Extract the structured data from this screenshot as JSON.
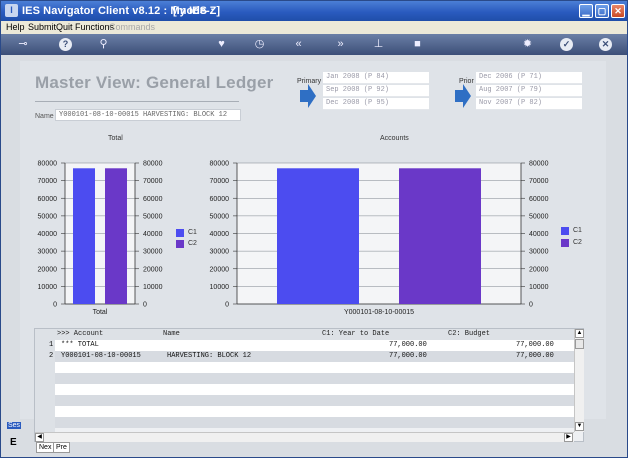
{
  "window": {
    "title": "IES Navigator Client v8.12 : My IES :",
    "mode": "[mode-Z]",
    "icon_letter": "I"
  },
  "menu": [
    "Help",
    "Submit",
    "Quit",
    "Functions",
    "Commands"
  ],
  "menu_disabled": [
    "Commands"
  ],
  "toolbar_icons": [
    "key-icon",
    "help-icon",
    "search-icon",
    "heart-icon",
    "clock-icon",
    "rewind-icon",
    "fast-forward-icon",
    "pin-icon",
    "stop-icon",
    "settings-icon",
    "check-icon",
    "close-icon"
  ],
  "view": {
    "title": "Master View: General Ledger",
    "name_label": "Name",
    "name_value": "Y000101-08-10-00015 HARVESTING: BLOCK 12"
  },
  "primary": {
    "label": "Primary",
    "periods": [
      "Jan 2008 (P 84)",
      "Sep 2008 (P 92)",
      "Dec 2008 (P 95)"
    ]
  },
  "prior": {
    "label": "Prior",
    "periods": [
      "Dec 2006 (P 71)",
      "Aug 2007 (P 79)",
      "Nov 2007 (P 82)"
    ]
  },
  "colors": {
    "c1": "#4c4cf0",
    "c2": "#6a38c8",
    "accent": "#2f6fc4"
  },
  "legend": {
    "c1": "C1",
    "c2": "C2"
  },
  "chart_data": [
    {
      "type": "bar",
      "title": "Total",
      "categories": [
        "Total"
      ],
      "series": [
        {
          "name": "C1",
          "values": [
            77000
          ]
        },
        {
          "name": "C2",
          "values": [
            77000
          ]
        }
      ],
      "yticks": [
        "80000",
        "70000",
        "60000",
        "50000",
        "40000",
        "30000",
        "20000",
        "10000",
        "0"
      ],
      "ylim": [
        0,
        80000
      ],
      "grid": true,
      "legend": "right"
    },
    {
      "type": "bar",
      "title": "Accounts",
      "categories": [
        "Y000101-08-10-00015"
      ],
      "series": [
        {
          "name": "C1",
          "values": [
            77000
          ]
        },
        {
          "name": "C2",
          "values": [
            77000
          ]
        }
      ],
      "yticks": [
        "80000",
        "70000",
        "60000",
        "50000",
        "40000",
        "30000",
        "20000",
        "10000",
        "0"
      ],
      "ylim": [
        0,
        80000
      ],
      "grid": true,
      "legend": "right"
    }
  ],
  "table": {
    "headers": [
      ">>> Account",
      "Name",
      "C1: Year to Date",
      "C2: Budget"
    ],
    "rows": [
      {
        "num": "1",
        "account": "*** TOTAL",
        "name": "",
        "ytd": "77,000.00",
        "budget": "77,000.00"
      },
      {
        "num": "2",
        "account": "Y000101-08-10-00015",
        "name": "HARVESTING: BLOCK 12",
        "ytd": "77,000.00",
        "budget": "77,000.00"
      }
    ]
  },
  "bottom_tabs": [
    "Nex",
    "Pre"
  ],
  "side": {
    "label": "Ses",
    "letter": "E"
  }
}
